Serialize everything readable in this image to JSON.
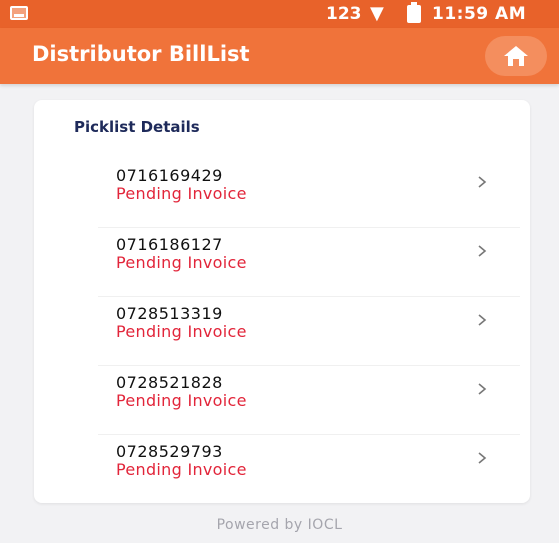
{
  "status_bar": {
    "indicator": "123",
    "time": "11:59 AM",
    "icons": [
      "notification-icon",
      "wifi-icon",
      "battery-icon"
    ]
  },
  "app_bar": {
    "title": "Distributor BillList",
    "home_icon": "home-icon"
  },
  "card": {
    "title": "Picklist Details",
    "items": [
      {
        "id": "0716169429",
        "status": "Pending Invoice"
      },
      {
        "id": "0716186127",
        "status": "Pending Invoice"
      },
      {
        "id": "0728513319",
        "status": "Pending Invoice"
      },
      {
        "id": "0728521828",
        "status": "Pending Invoice"
      },
      {
        "id": "0728529793",
        "status": "Pending Invoice"
      }
    ]
  },
  "footer": {
    "powered_by": "Powered by IOCL"
  },
  "colors": {
    "status_bar": "#e8622a",
    "app_bar": "#f0733a",
    "status_text": "#e2253a",
    "card_title": "#1e2a5a"
  }
}
